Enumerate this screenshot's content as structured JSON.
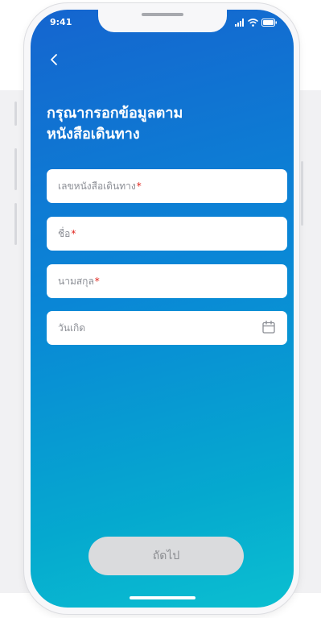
{
  "status_bar": {
    "time": "9:41",
    "icons": [
      "signal-icon",
      "wifi-icon",
      "battery-icon"
    ]
  },
  "header": {
    "back_icon": "chevron-left-icon",
    "title_line1": "กรุณากรอกข้อมูลตาม",
    "title_line2": "หนังสือเดินทาง"
  },
  "form": {
    "passport_number": {
      "placeholder": "เลขหนังสือเดินทาง",
      "required_mark": "*",
      "value": ""
    },
    "first_name": {
      "placeholder": "ชื่อ",
      "required_mark": "*",
      "value": ""
    },
    "last_name": {
      "placeholder": "นามสกุล",
      "required_mark": "*",
      "value": ""
    },
    "birth_date": {
      "placeholder": "วันเกิด",
      "icon": "calendar-icon",
      "value": ""
    }
  },
  "footer": {
    "next_label": "ถัดไป",
    "next_enabled": false
  },
  "colors": {
    "gradient_top": "#1565cf",
    "gradient_bottom": "#0bbfd0",
    "required": "#e0231b",
    "button_disabled_bg": "#dadbdd",
    "button_disabled_text": "#8a8c90"
  }
}
